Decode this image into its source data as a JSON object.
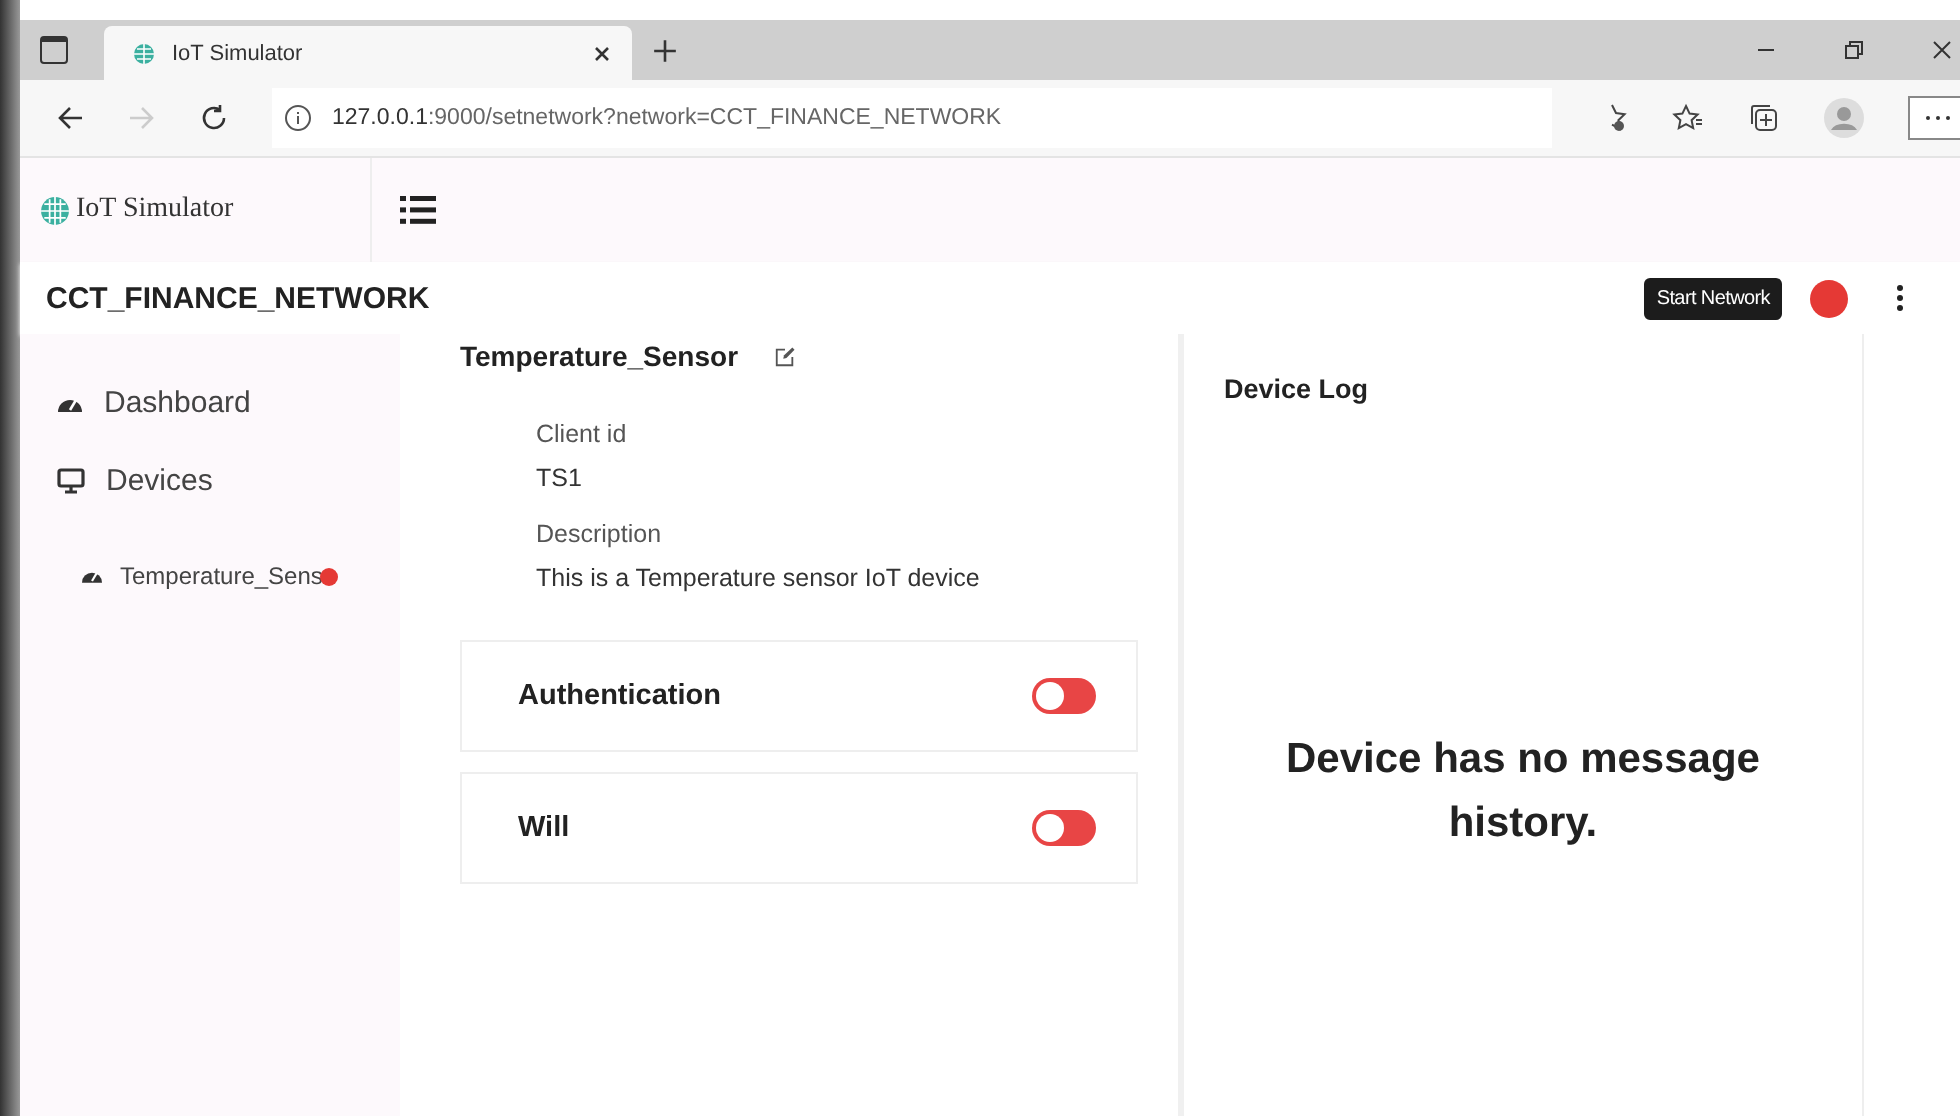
{
  "browser": {
    "tab_title": "IoT Simulator",
    "url_host": "127.0.0.1",
    "url_rest": ":9000/setnetwork?network=CCT_FINANCE_NETWORK"
  },
  "app": {
    "brand": "IoT Simulator",
    "network_name": "CCT_FINANCE_NETWORK",
    "tooltip": "Start Network",
    "network_running": false
  },
  "sidebar": {
    "items": [
      {
        "label": "Dashboard",
        "kind": "dashboard"
      },
      {
        "label": "Devices",
        "kind": "devices"
      }
    ],
    "devices": [
      {
        "label": "Temperature_Sens",
        "online": false
      }
    ]
  },
  "device": {
    "name": "Temperature_Sensor",
    "fields": [
      {
        "label": "Client id",
        "value": "TS1"
      },
      {
        "label": "Description",
        "value": "This is a Temperature sensor IoT device"
      }
    ],
    "settings": [
      {
        "label": "Authentication",
        "on": false
      },
      {
        "label": "Will",
        "on": false
      }
    ]
  },
  "log": {
    "title": "Device Log",
    "empty_message": "Device has no message history."
  }
}
